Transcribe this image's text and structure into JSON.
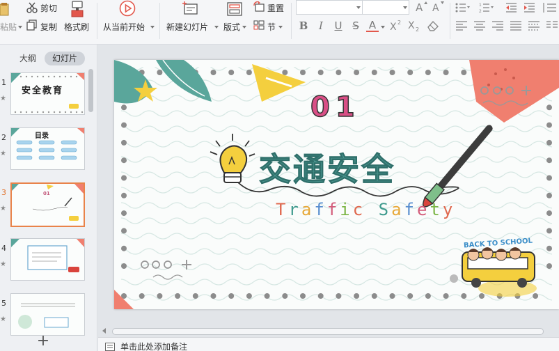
{
  "ribbon": {
    "paste_label": "粘贴",
    "cut_label": "剪切",
    "copy_label": "复制",
    "format_painter_label": "格式刷",
    "play_from_current_label": "从当前开始",
    "new_slide_label": "新建幻灯片",
    "layout_label": "版式",
    "reset_label": "重置",
    "section_label": "节"
  },
  "panel": {
    "outline_tab": "大纲",
    "slides_tab": "幻灯片",
    "thumbnails": [
      {
        "num": "1",
        "text": "安全教育"
      },
      {
        "num": "2",
        "text": "目录"
      },
      {
        "num": "3",
        "text": "01"
      },
      {
        "num": "4",
        "text": ""
      },
      {
        "num": "5",
        "text": ""
      }
    ]
  },
  "slide": {
    "number": "01",
    "title": "交通安全",
    "subtitle_letters": [
      "T",
      "r",
      "a",
      "f",
      "f",
      "i",
      "c",
      " ",
      "S",
      "a",
      "f",
      "e",
      "t",
      "y"
    ],
    "subtitle_colors": [
      "#e0694f",
      "#3f9b8e",
      "#e7a93a",
      "#5a8fd0",
      "#d35c7a",
      "#7bb545",
      "#e0694f",
      "",
      "#3f9b8e",
      "#e7a93a",
      "#5a8fd0",
      "#d35c7a",
      "#7bb545",
      "#e0694f"
    ],
    "badge": "BACK TO SCHOOL"
  },
  "notes": {
    "placeholder": "单击此处添加备注"
  },
  "colors": {
    "accent": "#e9834a",
    "teal": "#4b9690",
    "pink": "#f07f6f",
    "yellow": "#f4cf3e"
  }
}
